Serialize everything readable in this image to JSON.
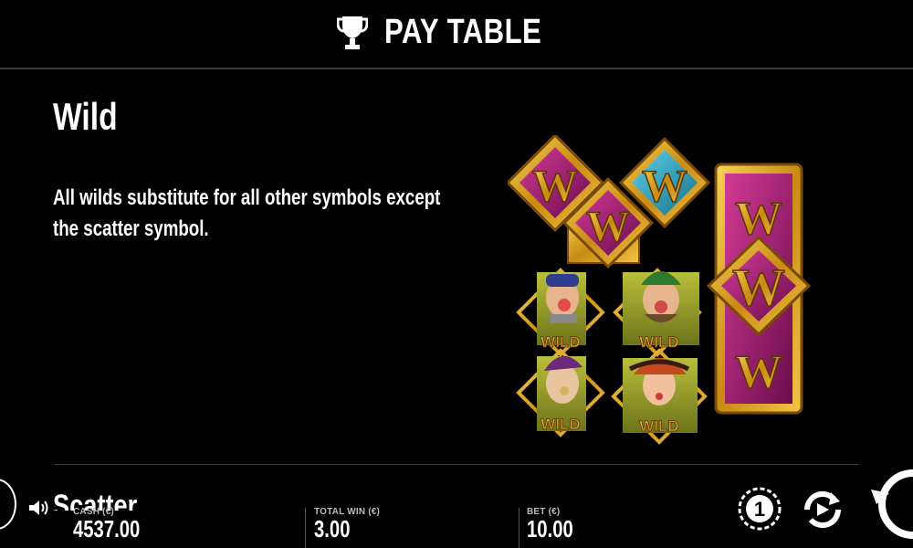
{
  "header": {
    "title": "PAY TABLE",
    "icon": "trophy-icon"
  },
  "section": {
    "heading": "Wild",
    "description": "All wilds substitute for all other symbols except the scatter symbol."
  },
  "art": {
    "wild_label": "WILD",
    "letter": "W",
    "colors": {
      "gold": "#d9a21a",
      "magenta": "#a0166f",
      "teal": "#2aa7c8",
      "green": "#8c9a2a"
    }
  },
  "next_section": {
    "heading": "Scatter"
  },
  "footer": {
    "cash": {
      "label": "CASH (€)",
      "value": "4537.00"
    },
    "total_win": {
      "label": "TOTAL WIN (€)",
      "value": "3.00"
    },
    "bet": {
      "label": "BET (€)",
      "value": "10.00"
    },
    "icons": [
      "sound-icon",
      "coin-value-icon",
      "autoplay-icon",
      "spin-icon"
    ]
  }
}
